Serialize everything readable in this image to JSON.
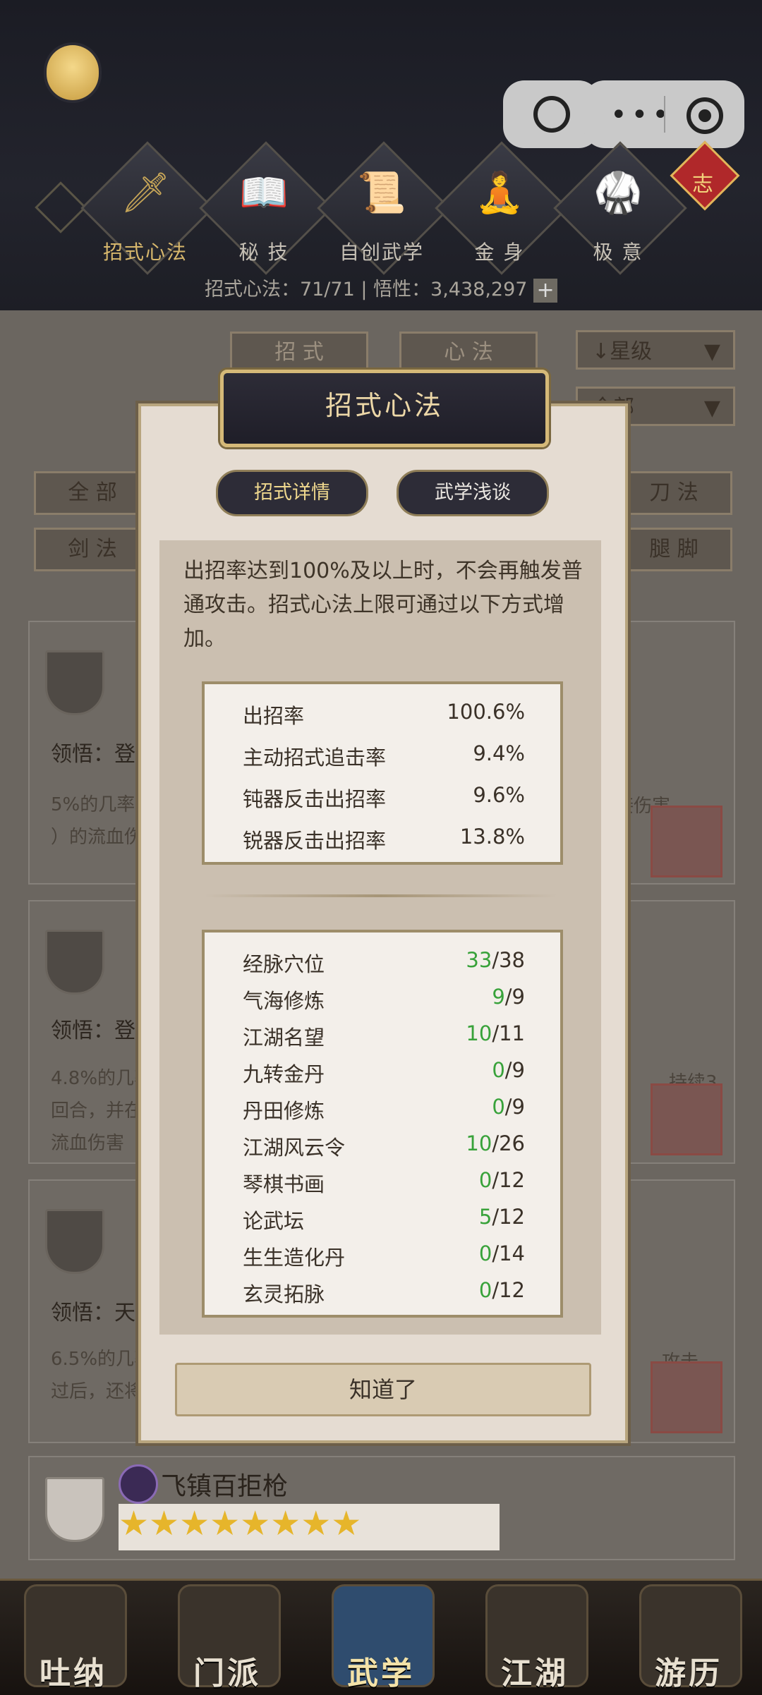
{
  "header": {
    "categories": [
      {
        "label": "招式心法",
        "icon": "sword-icon"
      },
      {
        "label": "秘 技",
        "icon": "book-icon"
      },
      {
        "label": "自创武学",
        "icon": "scroll-icon"
      },
      {
        "label": "金 身",
        "icon": "meditation-icon"
      },
      {
        "label": "极 意",
        "icon": "martial-stance-icon"
      }
    ],
    "knot_char": "志",
    "summary": "招式心法：71/71  |  悟性：3,438,297"
  },
  "background": {
    "segments": [
      "招 式",
      "心 法"
    ],
    "sort_dropdown": "↓星级",
    "filter_dropdown": "全部",
    "filters_left": [
      "全 部",
      "剑 法"
    ],
    "filters_right": [
      "刀 法",
      "腿 脚"
    ],
    "cards": [
      {
        "lingwu": "领悟：登",
        "desc": "5%的几率\n）的流血伤",
        "desc_right": "接伤害"
      },
      {
        "lingwu": "领悟：登",
        "desc": "4.8%的几率\n回合，并在\n流血伤害",
        "desc_right": "，持续3\n33%的"
      },
      {
        "lingwu": "领悟：天",
        "desc": "6.5%的几率\n过后，还将",
        "desc_right": "攻击"
      }
    ],
    "last_card_title": "飞镇百拒枪",
    "last_card_stars": 8
  },
  "modal": {
    "title": "招式心法",
    "tabs": [
      "招式详情",
      "武学浅谈"
    ],
    "intro": "出招率达到100%及以上时，不会再触发普通攻击。招式心法上限可通过以下方式增加。",
    "rates": [
      {
        "label": "出招率",
        "value": "100.6%"
      },
      {
        "label": "主动招式追击率",
        "value": "9.4%"
      },
      {
        "label": "钝器反击出招率",
        "value": "9.6%"
      },
      {
        "label": "锐器反击出招率",
        "value": "13.8%"
      }
    ],
    "sources": [
      {
        "label": "经脉穴位",
        "cur": "33",
        "max": "/38"
      },
      {
        "label": "气海修炼",
        "cur": "9",
        "max": "/9"
      },
      {
        "label": "江湖名望",
        "cur": "10",
        "max": "/11"
      },
      {
        "label": "九转金丹",
        "cur": "0",
        "max": "/9"
      },
      {
        "label": "丹田修炼",
        "cur": "0",
        "max": "/9"
      },
      {
        "label": "江湖风云令",
        "cur": "10",
        "max": "/26"
      },
      {
        "label": "琴棋书画",
        "cur": "0",
        "max": "/12"
      },
      {
        "label": "论武坛",
        "cur": "5",
        "max": "/12"
      },
      {
        "label": "生生造化丹",
        "cur": "0",
        "max": "/14"
      },
      {
        "label": "玄灵拓脉",
        "cur": "0",
        "max": "/12"
      }
    ],
    "ok_button": "知道了"
  },
  "nav": [
    "吐纳",
    "门派",
    "武学",
    "江湖",
    "游历"
  ]
}
